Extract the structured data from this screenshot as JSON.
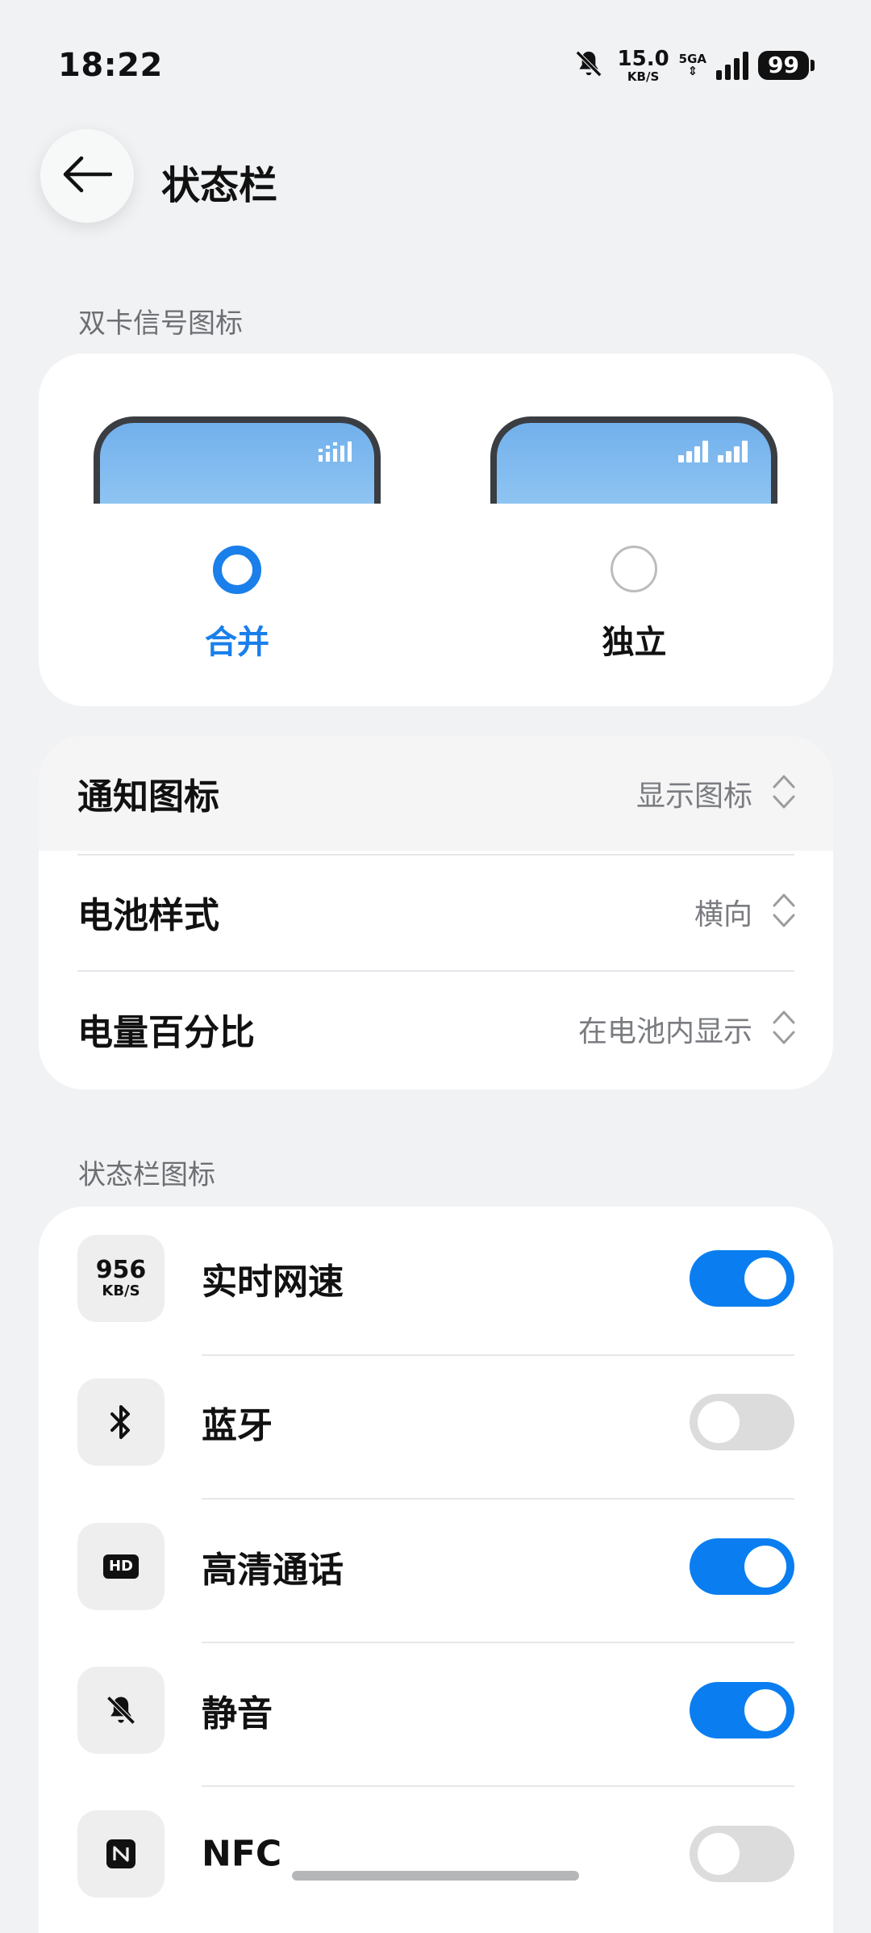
{
  "status_bar": {
    "time": "18:22",
    "net_speed_value": "15.0",
    "net_speed_unit": "KB/S",
    "network_type": "5GA",
    "battery_level": "99"
  },
  "header": {
    "title": "状态栏"
  },
  "dual_sim": {
    "section_label": "双卡信号图标",
    "options": [
      {
        "label": "合并",
        "selected": true
      },
      {
        "label": "独立",
        "selected": false
      }
    ]
  },
  "settings": [
    {
      "label": "通知图标",
      "value": "显示图标"
    },
    {
      "label": "电池样式",
      "value": "横向"
    },
    {
      "label": "电量百分比",
      "value": "在电池内显示"
    }
  ],
  "status_icons": {
    "section_label": "状态栏图标",
    "items": [
      {
        "label": "实时网速",
        "icon": "net-speed-icon",
        "icon_text_top": "956",
        "icon_text_bottom": "KB/S",
        "enabled": true
      },
      {
        "label": "蓝牙",
        "icon": "bluetooth-icon",
        "enabled": false
      },
      {
        "label": "高清通话",
        "icon": "hd-call-icon",
        "icon_text_top": "HD",
        "enabled": true
      },
      {
        "label": "静音",
        "icon": "mute-bell-icon",
        "enabled": true
      },
      {
        "label": "NFC",
        "icon": "nfc-icon",
        "enabled": false
      }
    ]
  },
  "colors": {
    "accent": "#0a7ef0",
    "background": "#f1f2f4",
    "toggle_off": "#dcdcdc"
  }
}
